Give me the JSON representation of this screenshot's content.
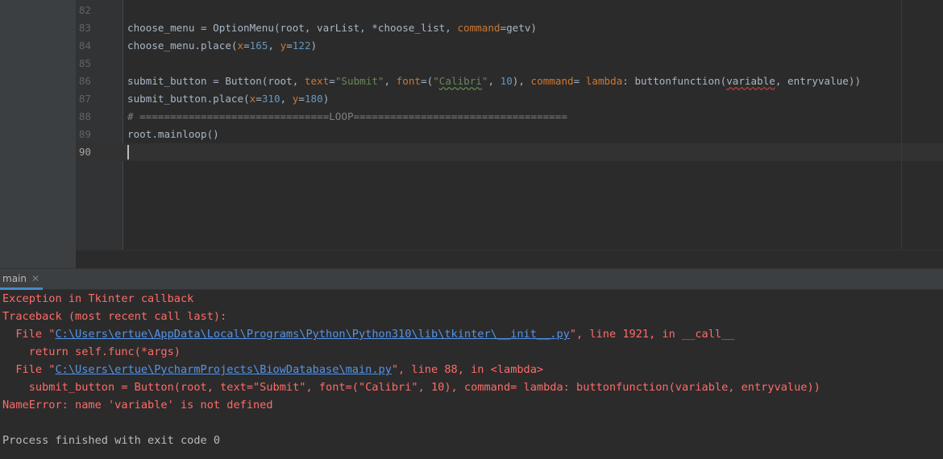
{
  "editor": {
    "lines": [
      {
        "number": "82",
        "tokens": []
      },
      {
        "number": "83",
        "tokens": [
          {
            "t": "choose_menu = OptionMenu(root, varList, *choose_list, ",
            "c": "id"
          },
          {
            "t": "command",
            "c": "kw"
          },
          {
            "t": "=getv)",
            "c": "id"
          }
        ]
      },
      {
        "number": "84",
        "tokens": [
          {
            "t": "choose_menu.place(",
            "c": "id"
          },
          {
            "t": "x",
            "c": "kw"
          },
          {
            "t": "=",
            "c": "id"
          },
          {
            "t": "165",
            "c": "num"
          },
          {
            "t": ", ",
            "c": "id"
          },
          {
            "t": "y",
            "c": "kw"
          },
          {
            "t": "=",
            "c": "id"
          },
          {
            "t": "122",
            "c": "num"
          },
          {
            "t": ")",
            "c": "id"
          }
        ]
      },
      {
        "number": "85",
        "tokens": []
      },
      {
        "number": "86",
        "tokens": [
          {
            "t": "submit_button = Button(root, ",
            "c": "id"
          },
          {
            "t": "text",
            "c": "kw"
          },
          {
            "t": "=",
            "c": "id"
          },
          {
            "t": "\"Submit\"",
            "c": "str"
          },
          {
            "t": ", ",
            "c": "id"
          },
          {
            "t": "font",
            "c": "kw"
          },
          {
            "t": "=(",
            "c": "id"
          },
          {
            "t": "\"",
            "c": "str"
          },
          {
            "t": "Calibri",
            "c": "str-typo"
          },
          {
            "t": "\"",
            "c": "str"
          },
          {
            "t": ", ",
            "c": "id"
          },
          {
            "t": "10",
            "c": "num"
          },
          {
            "t": "), ",
            "c": "id"
          },
          {
            "t": "command",
            "c": "kw"
          },
          {
            "t": "= ",
            "c": "id"
          },
          {
            "t": "lambda",
            "c": "kw"
          },
          {
            "t": ": buttonfunction(",
            "c": "id"
          },
          {
            "t": "variable",
            "c": "id-err"
          },
          {
            "t": ", entryvalue))",
            "c": "id"
          }
        ]
      },
      {
        "number": "87",
        "tokens": [
          {
            "t": "submit_button.place(",
            "c": "id"
          },
          {
            "t": "x",
            "c": "kw"
          },
          {
            "t": "=",
            "c": "id"
          },
          {
            "t": "310",
            "c": "num"
          },
          {
            "t": ", ",
            "c": "id"
          },
          {
            "t": "y",
            "c": "kw"
          },
          {
            "t": "=",
            "c": "id"
          },
          {
            "t": "180",
            "c": "num"
          },
          {
            "t": ")",
            "c": "id"
          }
        ]
      },
      {
        "number": "88",
        "tokens": [
          {
            "t": "# ===============================LOOP===================================",
            "c": "cm"
          }
        ]
      },
      {
        "number": "89",
        "tokens": [
          {
            "t": "root.mainloop()",
            "c": "id"
          }
        ]
      },
      {
        "number": "90",
        "tokens": [],
        "active": true
      }
    ]
  },
  "run_panel": {
    "tab_label": "main",
    "close_glyph": "✕"
  },
  "console": {
    "lines": [
      {
        "kind": "error",
        "parts": [
          {
            "t": "Exception in Tkinter callback"
          }
        ]
      },
      {
        "kind": "error",
        "parts": [
          {
            "t": "Traceback (most recent call last):"
          }
        ]
      },
      {
        "kind": "error",
        "parts": [
          {
            "t": "  File \""
          },
          {
            "t": "C:\\Users\\ertue\\AppData\\Local\\Programs\\Python\\Python310\\lib\\tkinter\\__init__.py",
            "link": true
          },
          {
            "t": "\", line 1921, in __call__"
          }
        ]
      },
      {
        "kind": "error",
        "parts": [
          {
            "t": "    return self.func(*args)"
          }
        ]
      },
      {
        "kind": "error",
        "parts": [
          {
            "t": "  File \""
          },
          {
            "t": "C:\\Users\\ertue\\PycharmProjects\\BiowDatabase\\main.py",
            "link": true
          },
          {
            "t": "\", line 88, in <lambda>"
          }
        ]
      },
      {
        "kind": "error",
        "parts": [
          {
            "t": "    submit_button = Button(root, text=\"Submit\", font=(\"Calibri\", 10), command= lambda: buttonfunction(variable, entryvalue))"
          }
        ]
      },
      {
        "kind": "error",
        "parts": [
          {
            "t": "NameError: name 'variable' is not defined"
          }
        ]
      },
      {
        "kind": "plain",
        "parts": [
          {
            "t": ""
          }
        ]
      },
      {
        "kind": "plain",
        "parts": [
          {
            "t": "Process finished with exit code 0"
          }
        ]
      }
    ]
  },
  "colors": {
    "keyword": "#cc7832",
    "number": "#6897bb",
    "string": "#6a8759",
    "comment": "#808080",
    "identifier": "#a9b7c6",
    "error_text": "#ff6b68",
    "link": "#5394ec"
  }
}
